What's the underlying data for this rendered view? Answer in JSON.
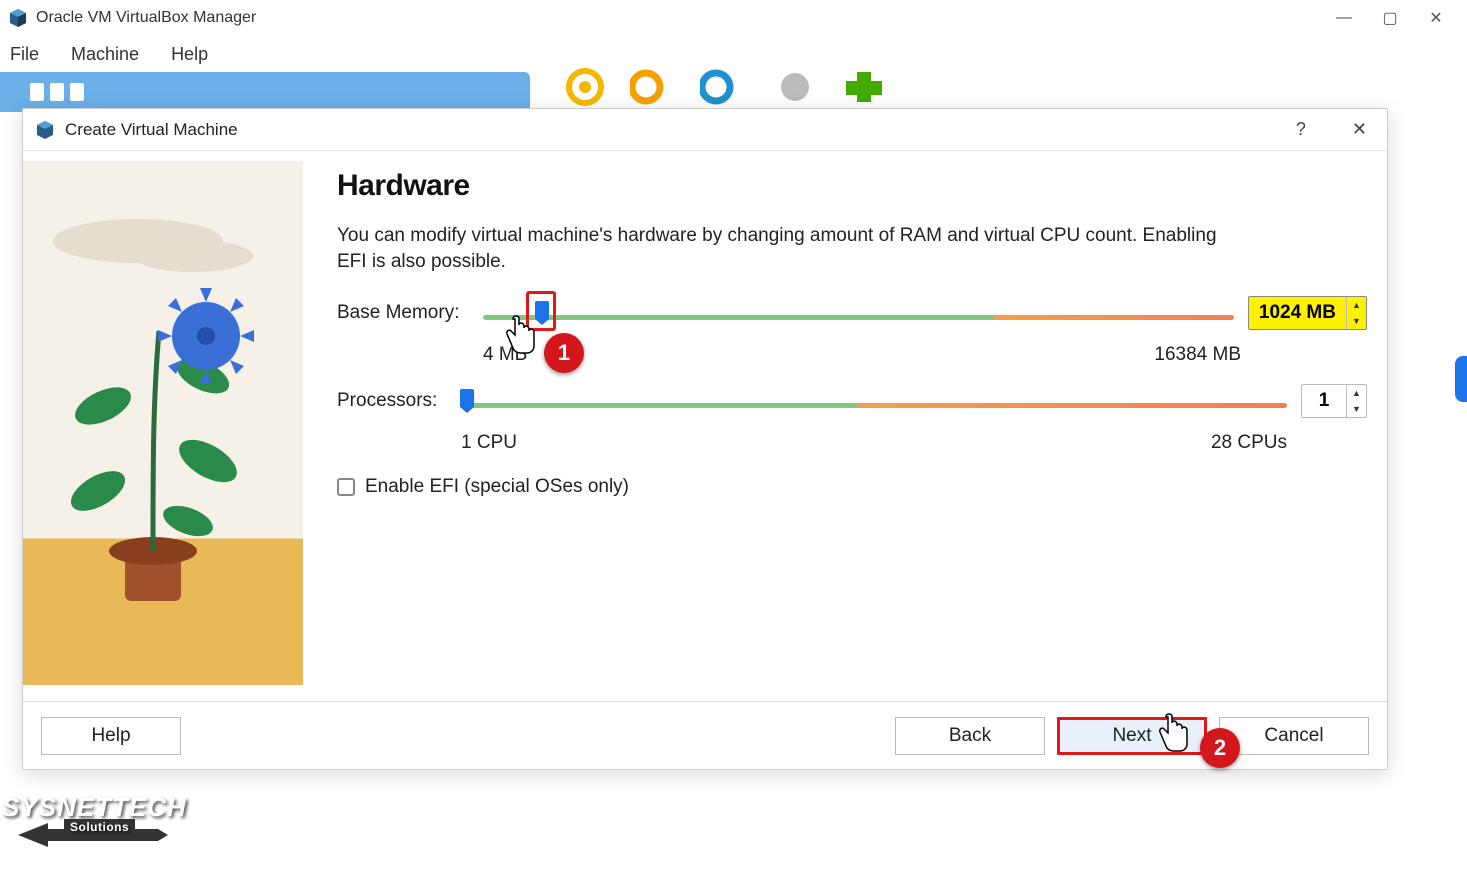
{
  "app": {
    "title": "Oracle VM VirtualBox Manager",
    "menus": [
      "File",
      "Machine",
      "Help"
    ],
    "window_controls": {
      "min": "—",
      "max": "▢",
      "close": "✕"
    }
  },
  "dialog": {
    "title": "Create Virtual Machine",
    "help_char": "?",
    "close_char": "✕",
    "heading": "Hardware",
    "description": "You can modify virtual machine's hardware by changing amount of RAM and virtual CPU count. Enabling EFI is also possible.",
    "memory": {
      "label": "Base Memory:",
      "min_label": "4 MB",
      "max_label": "16384 MB",
      "value": "1024 MB"
    },
    "cpu": {
      "label": "Processors:",
      "min_label": "1 CPU",
      "max_label": "28 CPUs",
      "value": "1"
    },
    "efi_label": "Enable EFI (special OSes only)",
    "buttons": {
      "help": "Help",
      "back": "Back",
      "next": "Next",
      "cancel": "Cancel"
    }
  },
  "annotations": {
    "badge1": "1",
    "badge2": "2"
  },
  "watermark": {
    "line1": "SYSNETTECH",
    "line2": "Solutions"
  }
}
